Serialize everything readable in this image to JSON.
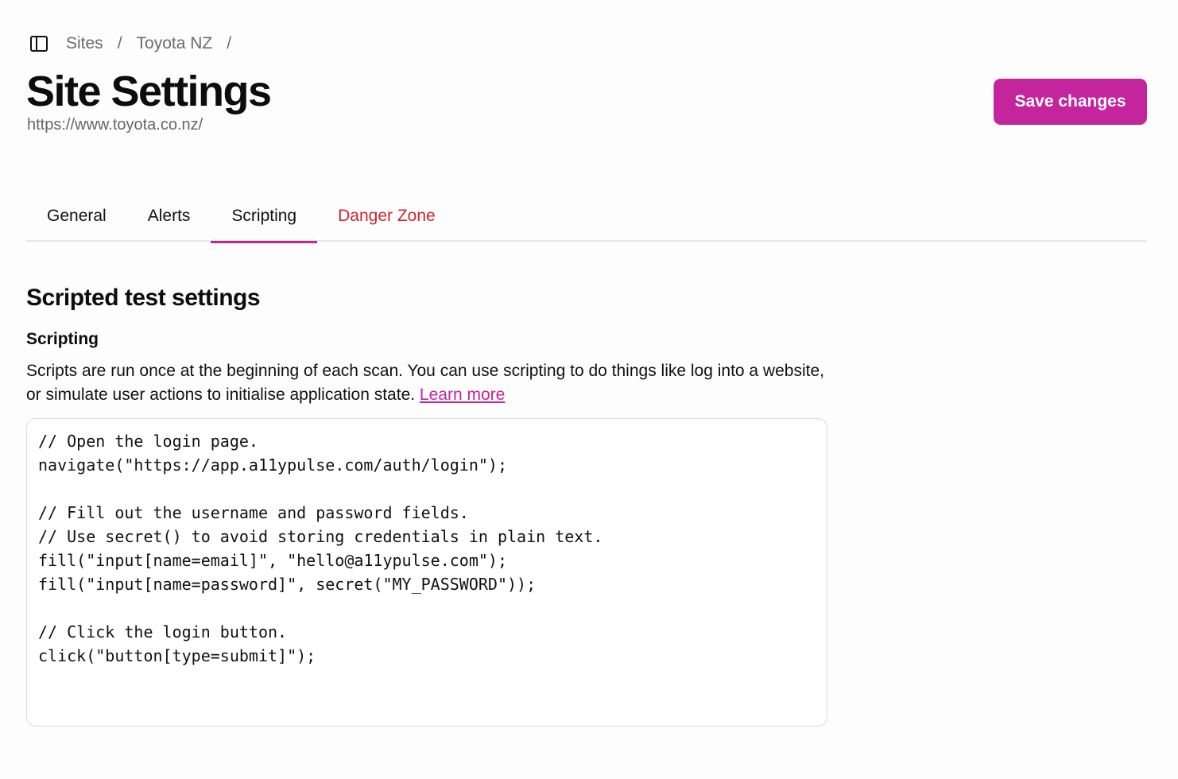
{
  "breadcrumb": {
    "toggle_icon": "sidebar-toggle-icon",
    "items": [
      "Sites",
      "Toyota NZ"
    ],
    "separator": "/"
  },
  "header": {
    "title": "Site Settings",
    "url": "https://www.toyota.co.nz/",
    "save_label": "Save changes"
  },
  "tabs": [
    {
      "label": "General",
      "active": false
    },
    {
      "label": "Alerts",
      "active": false
    },
    {
      "label": "Scripting",
      "active": true
    },
    {
      "label": "Danger Zone",
      "active": false
    }
  ],
  "section": {
    "title": "Scripted test settings",
    "subtitle": "Scripting",
    "description": "Scripts are run once at the beginning of each scan. You can use scripting to do things like log into a website, or simulate user actions to initialise application state. ",
    "learn_more": "Learn more"
  },
  "code": {
    "lines": [
      "// Open the login page.",
      "navigate(\"https://app.a11ypulse.com/auth/login\");",
      "",
      "// Fill out the username and password fields.",
      "// Use secret() to avoid storing credentials in plain text.",
      "fill(\"input[name=email]\", \"hello@a11ypulse.com\");",
      "fill(\"input[name=password]\", secret(\"MY_PASSWORD\"));",
      "",
      "// Click the login button.",
      "click(\"button[type=submit]\");"
    ]
  },
  "colors": {
    "accent": "#c4249c",
    "danger": "#d1252d"
  }
}
